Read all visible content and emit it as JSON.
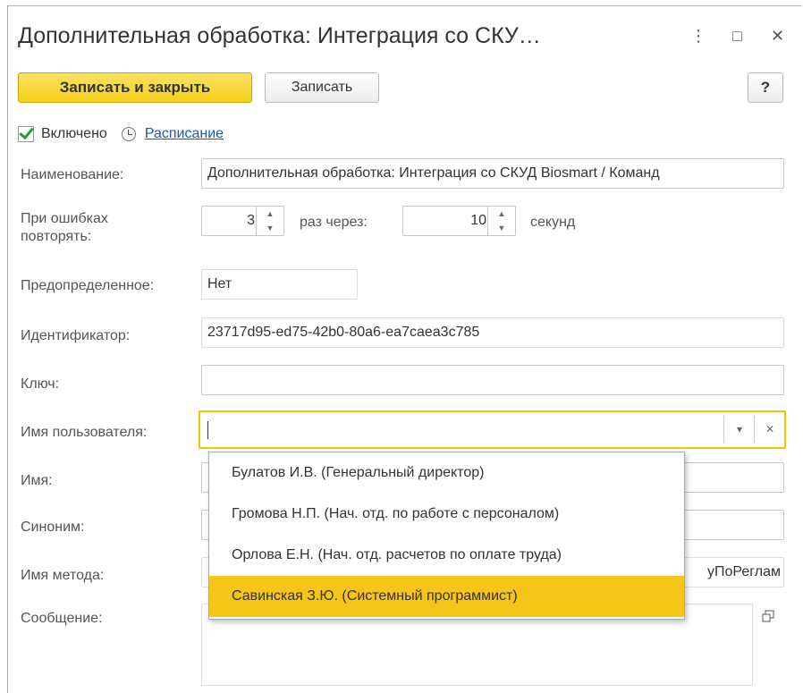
{
  "window": {
    "title": "Дополнительная обработка: Интеграция со СКУ…",
    "menu_icon": "⋮",
    "maximize_icon": "□",
    "close_icon": "✕"
  },
  "toolbar": {
    "save_close_label": "Записать и закрыть",
    "save_label": "Записать",
    "help_label": "?"
  },
  "enabled": {
    "checked": true,
    "label": "Включено",
    "schedule_link": "Расписание"
  },
  "form": {
    "name_label": "Наименование:",
    "name_value": "Дополнительная обработка: Интеграция со СКУД Biosmart / Команд",
    "retry_label": "При ошибках повторять:",
    "retry_count": "3",
    "times_through": "раз  через:",
    "retry_interval": "10",
    "seconds": "секунд",
    "predefined_label": "Предопределенное:",
    "predefined_value": "Нет",
    "id_label": "Идентификатор:",
    "id_value": "23717d95-ed75-42b0-80a6-ea7caea3c785",
    "key_label": "Ключ:",
    "key_value": "",
    "user_label": "Имя пользователя:",
    "user_value": "",
    "username_label": "Имя:",
    "synonym_label": "Синоним:",
    "method_label": "Имя метода:",
    "method_value_tail": "уПоРеглам",
    "message_label": "Сообщение:"
  },
  "user_dropdown": {
    "options": [
      "Булатов И.В. (Генеральный директор)",
      "Громова Н.П. (Нач. отд. по работе с персоналом)",
      "Орлова Е.Н. (Нач. отд. расчетов по оплате труда)",
      "Савинская З.Ю. (Системный программист)"
    ],
    "selected_index": 3
  },
  "colors": {
    "accent": "#f5c518",
    "link": "#1a57b3",
    "check": "#1e9e3a"
  }
}
